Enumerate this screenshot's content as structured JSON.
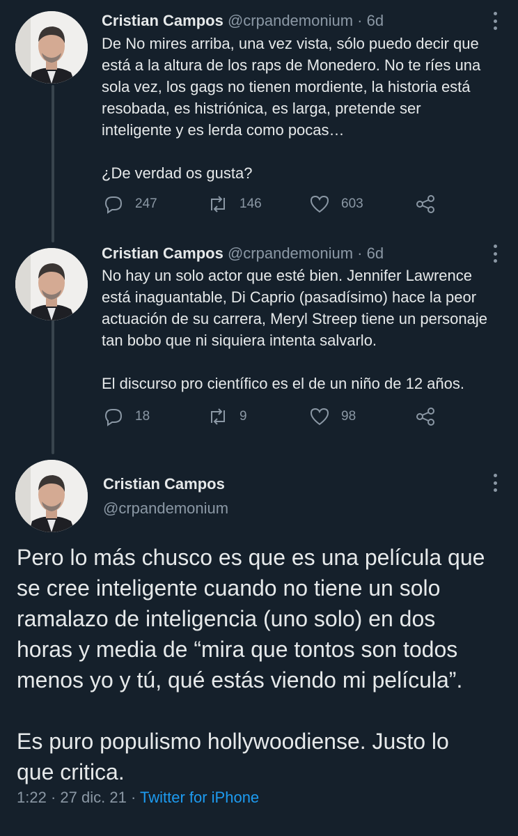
{
  "tweets": [
    {
      "name": "Cristian Campos",
      "handle": "@crpandemonium",
      "separator": "·",
      "time": "6d",
      "text_lines": [
        "De No mires arriba, una vez vista, sólo puedo decir que",
        "está a la altura de los raps de Monedero. No te ríes una",
        "sola vez, los gags no tienen mordiente, la historia está",
        "resobada, es histriónica, es larga, pretende ser",
        "inteligente y es lerda como pocas…",
        "",
        "¿De verdad os gusta?"
      ],
      "replies": "247",
      "retweets": "146",
      "likes": "603"
    },
    {
      "name": "Cristian Campos",
      "handle": "@crpandemonium",
      "separator": "·",
      "time": "6d",
      "text_lines": [
        "No hay un solo actor que esté bien. Jennifer Lawrence",
        "está inaguantable, Di Caprio (pasadísimo) hace la peor",
        "actuación de su carrera, Meryl Streep tiene un personaje",
        "tan bobo que ni siquiera intenta salvarlo.",
        "",
        "El discurso pro científico es el de un niño de 12 años."
      ],
      "replies": "18",
      "retweets": "9",
      "likes": "98"
    }
  ],
  "main_tweet": {
    "name": "Cristian Campos",
    "handle": "@crpandemonium",
    "text_lines": [
      "Pero lo más chusco es que es una película que",
      "se cree inteligente cuando no tiene un solo",
      "ramalazo de inteligencia (uno solo) en dos",
      "horas y media de “mira que tontos son todos",
      "menos yo y tú, qué estás viendo mi película”.",
      "",
      "Es puro populismo hollywoodiense. Justo lo",
      "que critica."
    ],
    "time": "1:22",
    "separator": "·",
    "date": "27 dic. 21",
    "source": "Twitter for iPhone"
  },
  "icons": {
    "reply": "reply-icon",
    "retweet": "retweet-icon",
    "like": "heart-icon",
    "share": "share-icon",
    "more": "more-options-icon"
  },
  "colors": {
    "background": "#15202b",
    "text": "#e6e9ea",
    "secondary": "#8b98a5",
    "link": "#1d9bf0"
  }
}
